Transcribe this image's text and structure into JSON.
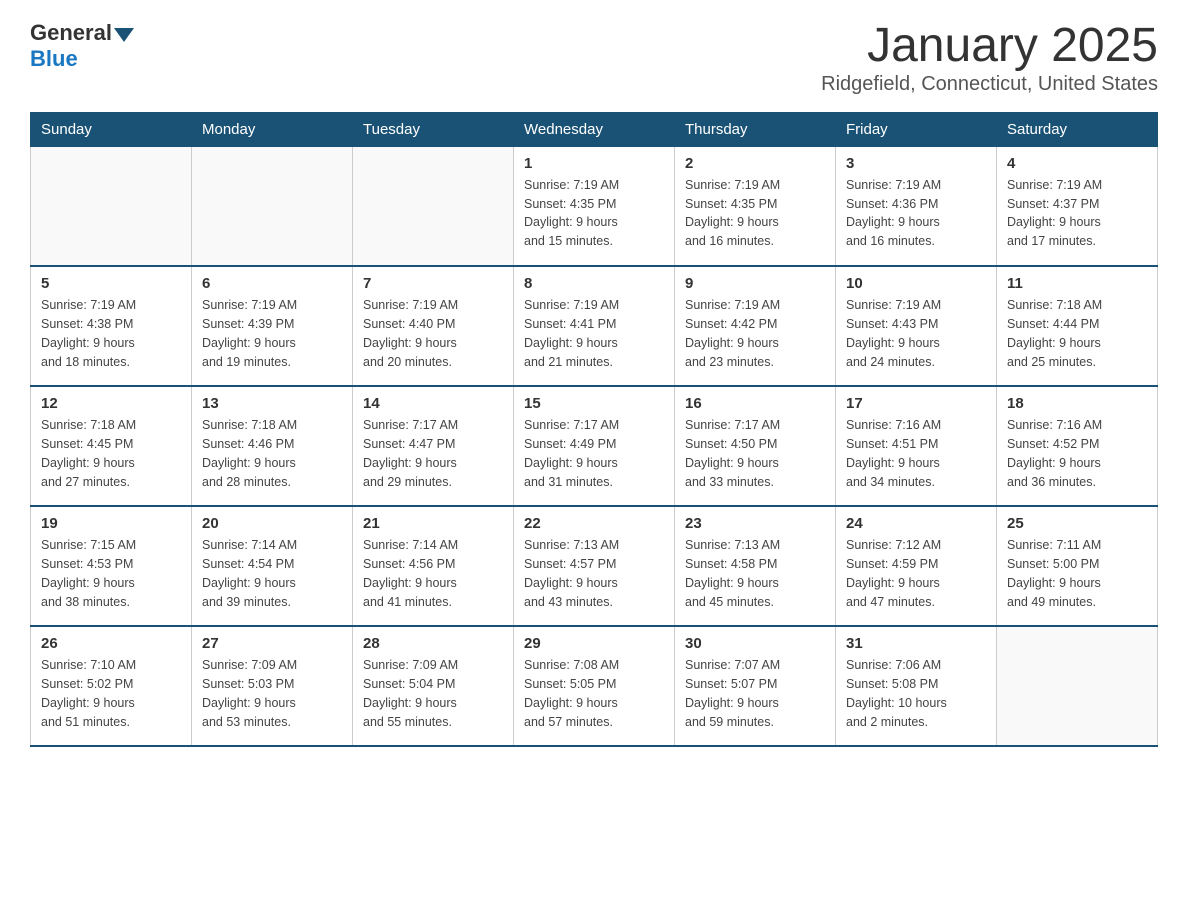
{
  "header": {
    "logo_general": "General",
    "logo_blue": "Blue",
    "title": "January 2025",
    "location": "Ridgefield, Connecticut, United States"
  },
  "weekdays": [
    "Sunday",
    "Monday",
    "Tuesday",
    "Wednesday",
    "Thursday",
    "Friday",
    "Saturday"
  ],
  "weeks": [
    [
      {
        "day": "",
        "info": ""
      },
      {
        "day": "",
        "info": ""
      },
      {
        "day": "",
        "info": ""
      },
      {
        "day": "1",
        "info": "Sunrise: 7:19 AM\nSunset: 4:35 PM\nDaylight: 9 hours\nand 15 minutes."
      },
      {
        "day": "2",
        "info": "Sunrise: 7:19 AM\nSunset: 4:35 PM\nDaylight: 9 hours\nand 16 minutes."
      },
      {
        "day": "3",
        "info": "Sunrise: 7:19 AM\nSunset: 4:36 PM\nDaylight: 9 hours\nand 16 minutes."
      },
      {
        "day": "4",
        "info": "Sunrise: 7:19 AM\nSunset: 4:37 PM\nDaylight: 9 hours\nand 17 minutes."
      }
    ],
    [
      {
        "day": "5",
        "info": "Sunrise: 7:19 AM\nSunset: 4:38 PM\nDaylight: 9 hours\nand 18 minutes."
      },
      {
        "day": "6",
        "info": "Sunrise: 7:19 AM\nSunset: 4:39 PM\nDaylight: 9 hours\nand 19 minutes."
      },
      {
        "day": "7",
        "info": "Sunrise: 7:19 AM\nSunset: 4:40 PM\nDaylight: 9 hours\nand 20 minutes."
      },
      {
        "day": "8",
        "info": "Sunrise: 7:19 AM\nSunset: 4:41 PM\nDaylight: 9 hours\nand 21 minutes."
      },
      {
        "day": "9",
        "info": "Sunrise: 7:19 AM\nSunset: 4:42 PM\nDaylight: 9 hours\nand 23 minutes."
      },
      {
        "day": "10",
        "info": "Sunrise: 7:19 AM\nSunset: 4:43 PM\nDaylight: 9 hours\nand 24 minutes."
      },
      {
        "day": "11",
        "info": "Sunrise: 7:18 AM\nSunset: 4:44 PM\nDaylight: 9 hours\nand 25 minutes."
      }
    ],
    [
      {
        "day": "12",
        "info": "Sunrise: 7:18 AM\nSunset: 4:45 PM\nDaylight: 9 hours\nand 27 minutes."
      },
      {
        "day": "13",
        "info": "Sunrise: 7:18 AM\nSunset: 4:46 PM\nDaylight: 9 hours\nand 28 minutes."
      },
      {
        "day": "14",
        "info": "Sunrise: 7:17 AM\nSunset: 4:47 PM\nDaylight: 9 hours\nand 29 minutes."
      },
      {
        "day": "15",
        "info": "Sunrise: 7:17 AM\nSunset: 4:49 PM\nDaylight: 9 hours\nand 31 minutes."
      },
      {
        "day": "16",
        "info": "Sunrise: 7:17 AM\nSunset: 4:50 PM\nDaylight: 9 hours\nand 33 minutes."
      },
      {
        "day": "17",
        "info": "Sunrise: 7:16 AM\nSunset: 4:51 PM\nDaylight: 9 hours\nand 34 minutes."
      },
      {
        "day": "18",
        "info": "Sunrise: 7:16 AM\nSunset: 4:52 PM\nDaylight: 9 hours\nand 36 minutes."
      }
    ],
    [
      {
        "day": "19",
        "info": "Sunrise: 7:15 AM\nSunset: 4:53 PM\nDaylight: 9 hours\nand 38 minutes."
      },
      {
        "day": "20",
        "info": "Sunrise: 7:14 AM\nSunset: 4:54 PM\nDaylight: 9 hours\nand 39 minutes."
      },
      {
        "day": "21",
        "info": "Sunrise: 7:14 AM\nSunset: 4:56 PM\nDaylight: 9 hours\nand 41 minutes."
      },
      {
        "day": "22",
        "info": "Sunrise: 7:13 AM\nSunset: 4:57 PM\nDaylight: 9 hours\nand 43 minutes."
      },
      {
        "day": "23",
        "info": "Sunrise: 7:13 AM\nSunset: 4:58 PM\nDaylight: 9 hours\nand 45 minutes."
      },
      {
        "day": "24",
        "info": "Sunrise: 7:12 AM\nSunset: 4:59 PM\nDaylight: 9 hours\nand 47 minutes."
      },
      {
        "day": "25",
        "info": "Sunrise: 7:11 AM\nSunset: 5:00 PM\nDaylight: 9 hours\nand 49 minutes."
      }
    ],
    [
      {
        "day": "26",
        "info": "Sunrise: 7:10 AM\nSunset: 5:02 PM\nDaylight: 9 hours\nand 51 minutes."
      },
      {
        "day": "27",
        "info": "Sunrise: 7:09 AM\nSunset: 5:03 PM\nDaylight: 9 hours\nand 53 minutes."
      },
      {
        "day": "28",
        "info": "Sunrise: 7:09 AM\nSunset: 5:04 PM\nDaylight: 9 hours\nand 55 minutes."
      },
      {
        "day": "29",
        "info": "Sunrise: 7:08 AM\nSunset: 5:05 PM\nDaylight: 9 hours\nand 57 minutes."
      },
      {
        "day": "30",
        "info": "Sunrise: 7:07 AM\nSunset: 5:07 PM\nDaylight: 9 hours\nand 59 minutes."
      },
      {
        "day": "31",
        "info": "Sunrise: 7:06 AM\nSunset: 5:08 PM\nDaylight: 10 hours\nand 2 minutes."
      },
      {
        "day": "",
        "info": ""
      }
    ]
  ]
}
